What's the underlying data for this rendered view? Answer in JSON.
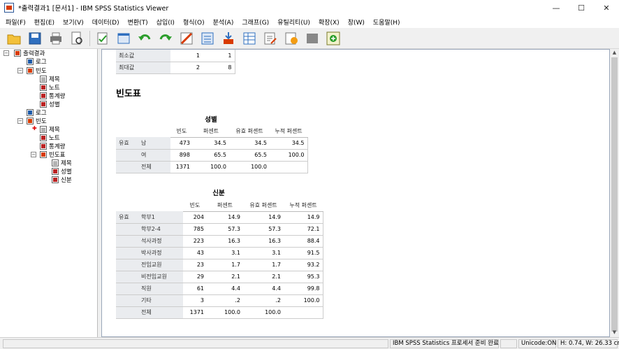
{
  "window": {
    "title": "*출력결과1 [문서1] - IBM SPSS Statistics Viewer",
    "minimize": "—",
    "maximize": "☐",
    "close": "✕"
  },
  "menu": [
    "파일(F)",
    "편집(E)",
    "보기(V)",
    "데이터(D)",
    "변환(T)",
    "삽입(I)",
    "형식(O)",
    "분석(A)",
    "그래프(G)",
    "유틸리티(U)",
    "확장(X)",
    "창(W)",
    "도움말(H)"
  ],
  "toolbar": {
    "icons": [
      "open-icon",
      "save-icon",
      "print-icon",
      "print-preview-icon",
      "export-icon",
      "recall-dialog-icon",
      "undo-icon",
      "redo-icon",
      "goto-data-icon",
      "goto-case-icon",
      "goto-variable-icon",
      "variables-icon",
      "insert-text-icon",
      "insert-chart-icon",
      "designate-window-icon",
      "add-icon"
    ]
  },
  "tree": {
    "root": "출력결과",
    "log1": "로그",
    "freq1": "빈도",
    "freq1_children": [
      "제목",
      "노트",
      "통계량",
      "성별"
    ],
    "log2": "로그",
    "freq2": "빈도",
    "freq2_children": [
      "제목",
      "노트",
      "통계량"
    ],
    "freqtable": "빈도표",
    "freqtable_children": [
      "제목",
      "성별",
      "신분"
    ]
  },
  "top_stats": {
    "rows": [
      {
        "label": "최소값",
        "v1": "1",
        "v2": "1"
      },
      {
        "label": "최대값",
        "v1": "2",
        "v2": "8"
      }
    ]
  },
  "section_title": "빈도표",
  "gender_table": {
    "title": "성별",
    "headers": [
      "빈도",
      "퍼센트",
      "유효 퍼센트",
      "누적 퍼센트"
    ],
    "group_label": "유효",
    "rows": [
      {
        "label": "남",
        "freq": "473",
        "pct": "34.5",
        "valid": "34.5",
        "cum": "34.5"
      },
      {
        "label": "여",
        "freq": "898",
        "pct": "65.5",
        "valid": "65.5",
        "cum": "100.0"
      },
      {
        "label": "전체",
        "freq": "1371",
        "pct": "100.0",
        "valid": "100.0",
        "cum": ""
      }
    ]
  },
  "status_table": {
    "title": "신분",
    "headers": [
      "빈도",
      "퍼센트",
      "유효 퍼센트",
      "누적 퍼센트"
    ],
    "group_label": "유효",
    "rows": [
      {
        "label": "학부1",
        "freq": "204",
        "pct": "14.9",
        "valid": "14.9",
        "cum": "14.9"
      },
      {
        "label": "학부2-4",
        "freq": "785",
        "pct": "57.3",
        "valid": "57.3",
        "cum": "72.1"
      },
      {
        "label": "석사과정",
        "freq": "223",
        "pct": "16.3",
        "valid": "16.3",
        "cum": "88.4"
      },
      {
        "label": "박사과정",
        "freq": "43",
        "pct": "3.1",
        "valid": "3.1",
        "cum": "91.5"
      },
      {
        "label": "전임교원",
        "freq": "23",
        "pct": "1.7",
        "valid": "1.7",
        "cum": "93.2"
      },
      {
        "label": "비전임교원",
        "freq": "29",
        "pct": "2.1",
        "valid": "2.1",
        "cum": "95.3"
      },
      {
        "label": "직원",
        "freq": "61",
        "pct": "4.4",
        "valid": "4.4",
        "cum": "99.8"
      },
      {
        "label": "기타",
        "freq": "3",
        "pct": ".2",
        "valid": ".2",
        "cum": "100.0"
      },
      {
        "label": "전체",
        "freq": "1371",
        "pct": "100.0",
        "valid": "100.0",
        "cum": ""
      }
    ]
  },
  "statusbar": {
    "processor": "IBM SPSS Statistics 프로세서 준비 완료",
    "unicode": "Unicode:ON",
    "dims": "H: 0.74, W: 26.33 cm"
  }
}
